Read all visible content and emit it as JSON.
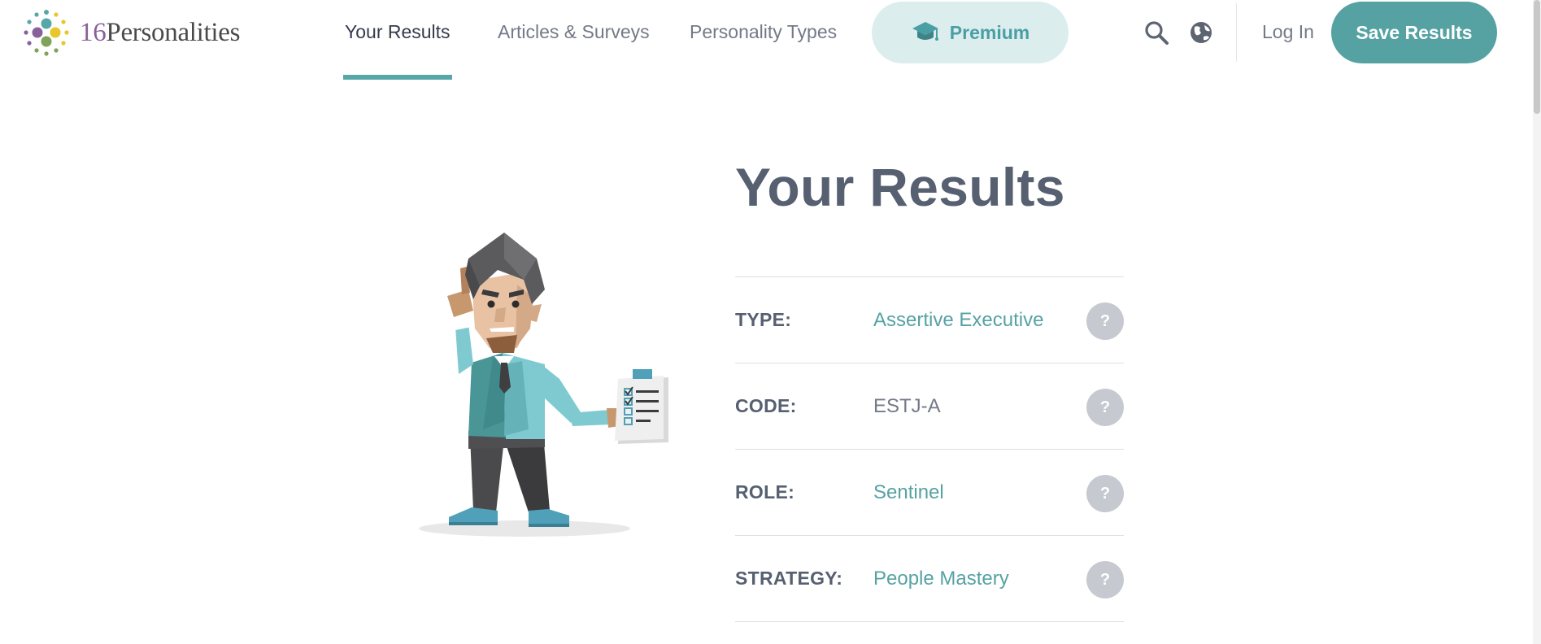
{
  "brand": {
    "number": "16",
    "name": "Personalities"
  },
  "nav": {
    "items": [
      {
        "label": "Your Results",
        "active": true
      },
      {
        "label": "Articles & Surveys",
        "active": false
      },
      {
        "label": "Personality Types",
        "active": false
      }
    ],
    "premium_label": "Premium",
    "icons": [
      "search-icon",
      "globe-icon"
    ],
    "login_label": "Log In",
    "save_label": "Save Results"
  },
  "main": {
    "title": "Your Results",
    "rows": [
      {
        "label": "TYPE:",
        "value": "Assertive Executive",
        "linked": true
      },
      {
        "label": "CODE:",
        "value": "ESTJ-A",
        "linked": false
      },
      {
        "label": "ROLE:",
        "value": "Sentinel",
        "linked": true
      },
      {
        "label": "STRATEGY:",
        "value": "People Mastery",
        "linked": true
      }
    ],
    "help_symbol": "?"
  },
  "colors": {
    "accent": "#56a2a3",
    "premium_bg": "#dcedee",
    "text": "#576071",
    "muted": "#737a87",
    "help_bg": "#c6c9cf"
  }
}
